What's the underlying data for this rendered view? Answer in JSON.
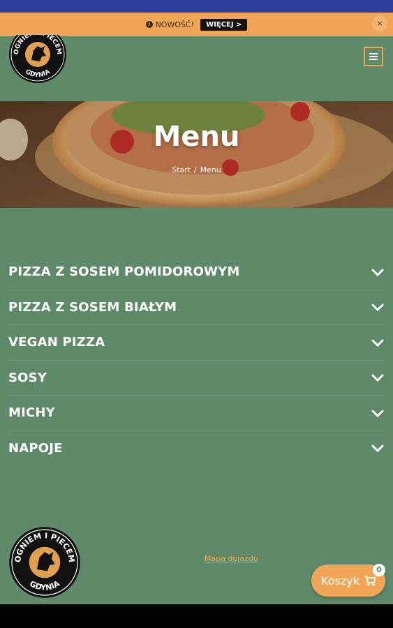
{
  "colors": {
    "status_bar": "#2e3c9c",
    "notice_bg": "#f0a656",
    "green": "#5f8a6a",
    "accent": "#f0a656"
  },
  "notice": {
    "info_icon": "info-circle-icon",
    "text": "NOWOŚĆ!",
    "button_label": "WIĘCEJ >",
    "close_label": "×"
  },
  "header": {
    "logo_text_top": "OGNIEM I PIECEM",
    "logo_text_bottom": "GDYNIA",
    "menu_icon": "hamburger-menu-icon"
  },
  "hero": {
    "title": "Menu",
    "breadcrumb": [
      "Start",
      "/",
      "Menu"
    ]
  },
  "categories": [
    {
      "label": "PIZZA Z SOSEM POMIDOROWYM"
    },
    {
      "label": "PIZZA Z SOSEM BIAŁYM"
    },
    {
      "label": "VEGAN PIZZA"
    },
    {
      "label": "SOSY"
    },
    {
      "label": "MICHY"
    },
    {
      "label": "NAPOJE"
    }
  ],
  "footer": {
    "logo_text_top": "OGNIEM I PIECEM",
    "logo_text_bottom": "GDYNIA",
    "link_label": "Mapa dojazdu"
  },
  "cart": {
    "label": "Koszyk",
    "icon": "shopping-cart-icon",
    "count": "0"
  }
}
